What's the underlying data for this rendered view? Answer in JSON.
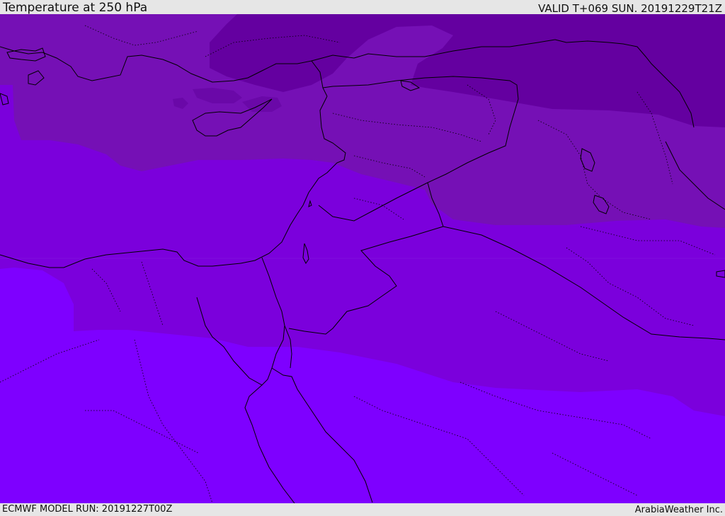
{
  "header": {
    "title": "Temperature at 250 hPa",
    "valid_time": "VALID T+069 SUN. 20191229T21Z"
  },
  "footer": {
    "model_run": "ECMWF MODEL RUN: 20191227T00Z",
    "credit": "ArabiaWeather Inc."
  },
  "colors": {
    "band_darkest": "#6400a0",
    "band_dark": "#7510b5",
    "band_mid": "#7b00dc",
    "band_light": "#7e00ff",
    "coastline": "#000000",
    "frame_bg": "#e6e6e6"
  }
}
